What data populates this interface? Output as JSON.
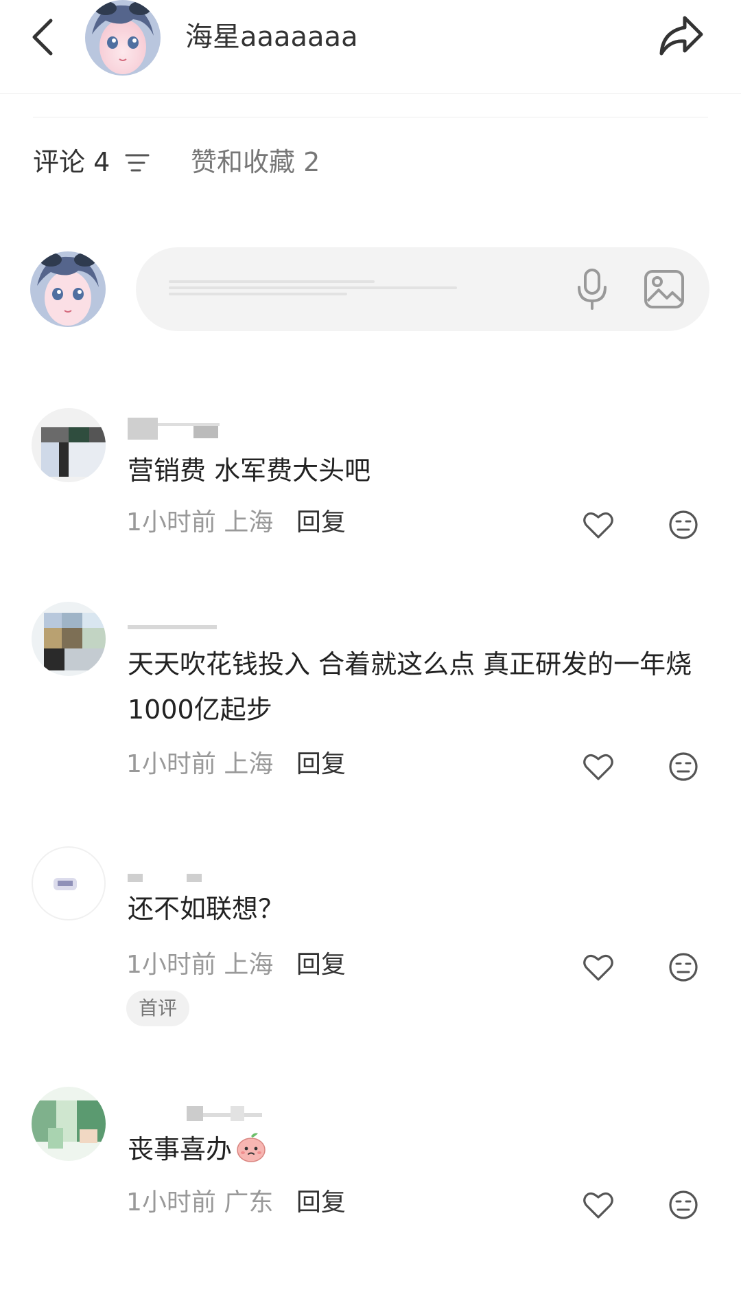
{
  "header": {
    "back_icon": "chevron-left-icon",
    "username": "海星aaaaaaa",
    "share_icon": "share-arrow-icon"
  },
  "tabs": {
    "comments": "评论 4",
    "likes_favorites": "赞和收藏 2",
    "sort_icon": "sort-lines-icon"
  },
  "composer": {
    "mic_icon": "microphone-icon",
    "image_icon": "image-icon"
  },
  "comments": [
    {
      "text": "营销费 水军费大头吧",
      "time": "1小时前",
      "location": "上海",
      "reply": "回复"
    },
    {
      "text": "天天吹花钱投入 合着就这么点 真正研发的一年烧1000亿起步",
      "time": "1小时前",
      "location": "上海",
      "reply": "回复"
    },
    {
      "text": "还不如联想？",
      "time": "1小时前",
      "location": "上海",
      "reply": "回复",
      "badge": "首评"
    },
    {
      "text": "丧事喜办",
      "time": "1小时前",
      "location": "广东",
      "reply": "回复"
    }
  ],
  "colors": {
    "text_primary": "#222222",
    "text_secondary": "#999999",
    "input_bg": "#f3f3f3",
    "divider": "#eeeeee"
  }
}
